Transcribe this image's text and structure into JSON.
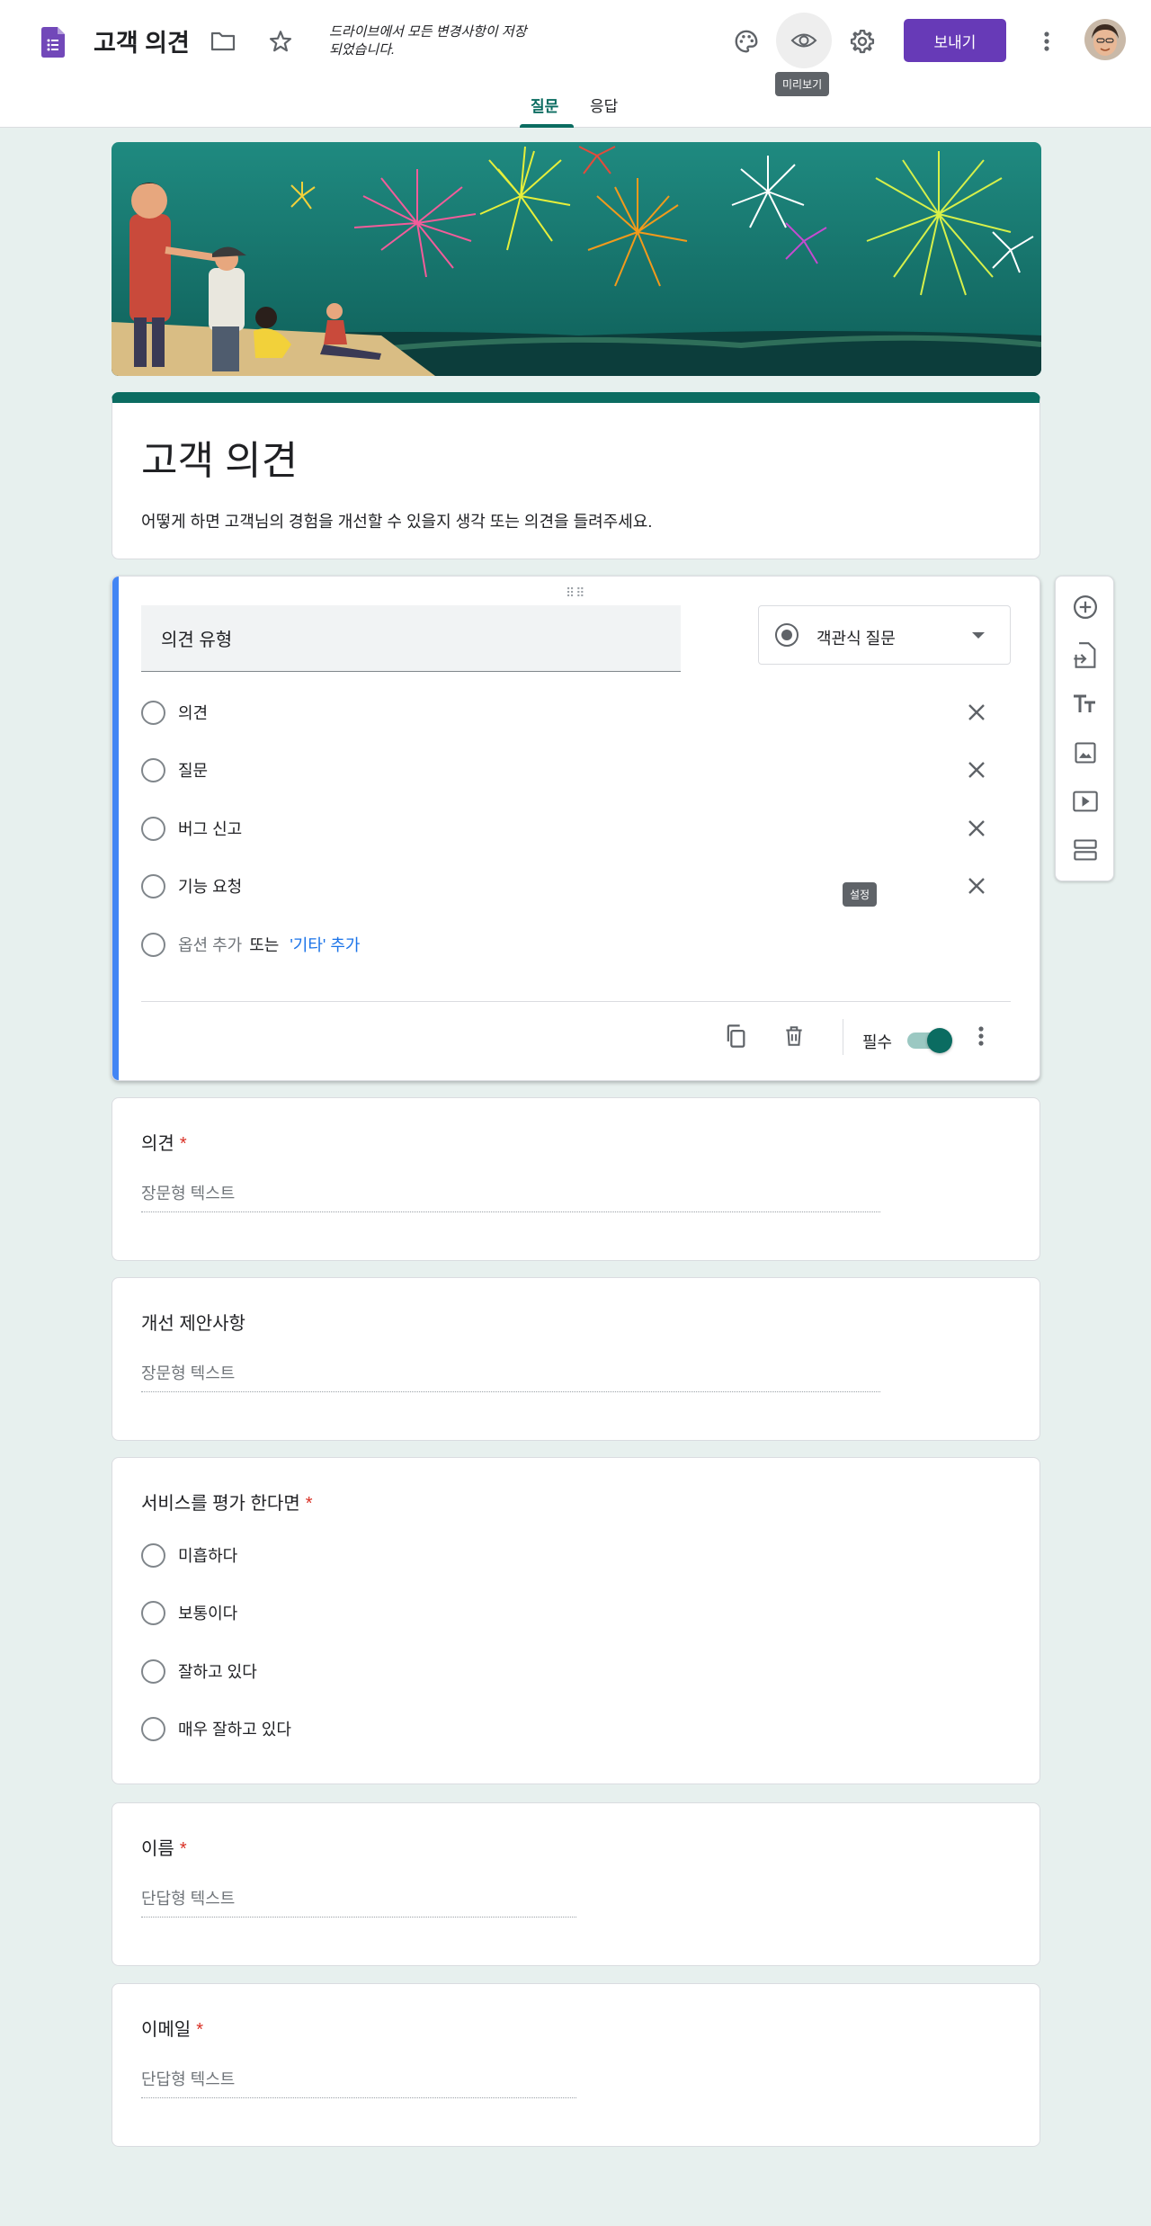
{
  "header": {
    "app_title": "고객 의견",
    "save_status": "드라이브에서 모든 변경사항이 저장되었습니다.",
    "preview_tooltip": "미리보기",
    "send_label": "보내기",
    "icons": [
      "forms-doc-icon",
      "folder-icon",
      "star-icon",
      "palette-icon",
      "eye-icon",
      "gear-icon",
      "more-vert-icon"
    ]
  },
  "tabs": [
    {
      "label": "질문",
      "active": true
    },
    {
      "label": "응답",
      "active": false
    }
  ],
  "form": {
    "title": "고객 의견",
    "description": "어떻게 하면 고객님의 경험을 개선할 수 있을지 생각 또는 의견을 들려주세요."
  },
  "active_question": {
    "title": "의견 유형",
    "type_label": "객관식 질문",
    "options": [
      "의견",
      "질문",
      "버그 신고",
      "기능 요청"
    ],
    "add_option": "옵션 추가",
    "or": "또는",
    "add_other": "'기타' 추가",
    "settings_tooltip": "설정",
    "required_label": "필수",
    "required": true
  },
  "questions": [
    {
      "title": "의견",
      "required": true,
      "placeholder": "장문형 텍스트"
    },
    {
      "title": "개선 제안사항",
      "required": false,
      "placeholder": "장문형 텍스트"
    },
    {
      "title": "서비스를 평가 한다면",
      "required": true,
      "options": [
        "미흡하다",
        "보통이다",
        "잘하고 있다",
        "매우 잘하고 있다"
      ]
    },
    {
      "title": "이름",
      "required": true,
      "placeholder": "단답형 텍스트"
    },
    {
      "title": "이메일",
      "required": true,
      "placeholder": "단답형 텍스트"
    }
  ],
  "required_mark": "*",
  "colors": {
    "accent": "#673ab7",
    "teal": "#0b6c61",
    "active_border": "#4285f4",
    "background": "#e7f0ee",
    "required_star": "#d93025",
    "link": "#1a73e8"
  },
  "toolbar_icons": [
    "add-question-icon",
    "import-questions-icon",
    "add-title-icon",
    "add-image-icon",
    "add-video-icon",
    "add-section-icon"
  ]
}
